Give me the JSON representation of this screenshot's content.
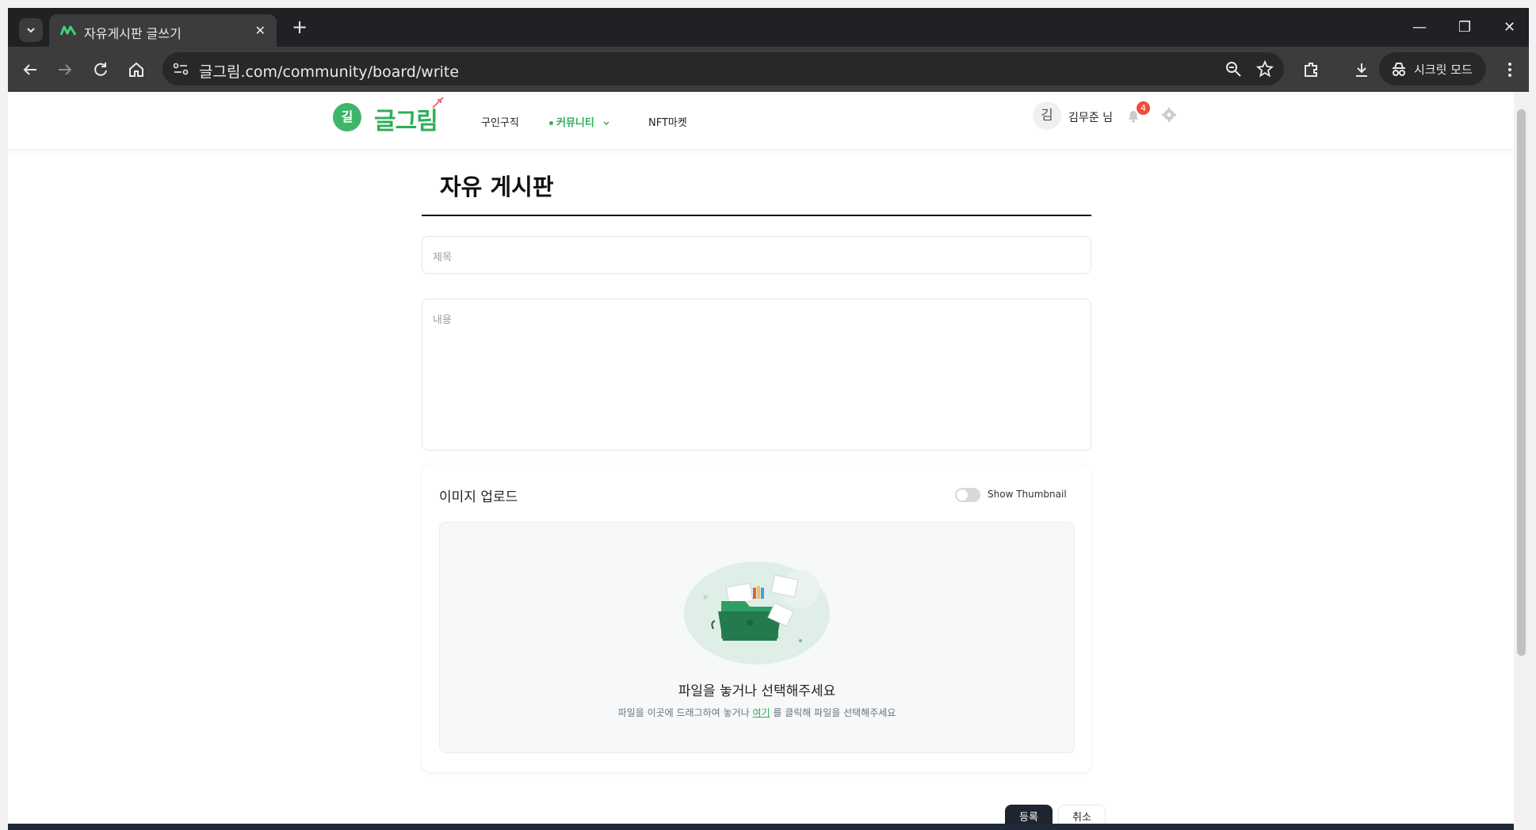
{
  "browser": {
    "tab_title": "자유게시판 글쓰기",
    "url": "글그림.com/community/board/write",
    "incognito_label": "시크릿 모드",
    "icons": [
      "tab-list-icon",
      "close-icon",
      "plus-icon",
      "minimize-icon",
      "restore-icon",
      "close-window-icon",
      "back-icon",
      "forward-icon",
      "reload-icon",
      "home-icon",
      "site-info-icon",
      "zoom-icon",
      "star-icon",
      "extensions-icon",
      "download-icon",
      "incognito-icon",
      "more-icon"
    ]
  },
  "header": {
    "logo_badge": "길",
    "logo_text": "글그림",
    "nav": [
      {
        "label": "구인구직"
      },
      {
        "label": "커뮤니티"
      },
      {
        "label": "NFT마켓"
      }
    ],
    "avatar_initial": "김",
    "username": "김무준 님",
    "notification_count": "4"
  },
  "main": {
    "board_title": "자유 게시판",
    "title_placeholder": "제목",
    "body_placeholder": "내용",
    "upload": {
      "title": "이미지 업로드",
      "toggle_label": "Show Thumbnail",
      "toggle_on": false,
      "drop_title": "파일을 놓거나 선택해주세요",
      "drop_sub_before": "파일을 이곳에 드래그하여 놓거나 ",
      "drop_link": "여기",
      "drop_sub_after": " 를 클릭해 파일을 선택해주세요"
    },
    "submit_label": "등록",
    "cancel_label": "취소"
  },
  "colors": {
    "brand_green": "#2fae5a",
    "dark_button": "#1f2530",
    "badge_red": "#f04b3a"
  }
}
